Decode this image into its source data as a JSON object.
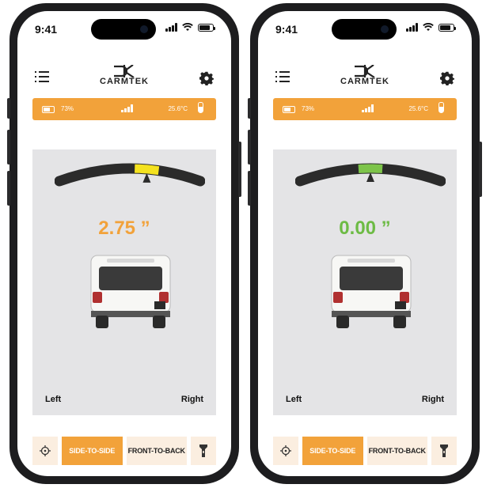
{
  "status": {
    "time": "9:41"
  },
  "brand": {
    "name": "CARMTEK"
  },
  "info": {
    "battery": "73%",
    "temperature": "25.6°C"
  },
  "labels": {
    "left": "Left",
    "right": "Right"
  },
  "tabs": {
    "side": "SIDE-TO-SIDE",
    "front": "FRONT-TO-BACK"
  },
  "icons": [
    "menu-icon",
    "gear-icon",
    "battery-icon",
    "signal-icon",
    "thermometer-icon",
    "target-icon",
    "flashlight-icon",
    "wifi-icon"
  ],
  "screens": [
    {
      "reading": "2.75 ”",
      "reading_color": "#f2a23a",
      "indicator_color": "#f4e21f",
      "indicator_level": 0.62
    },
    {
      "reading": "0.00 ”",
      "reading_color": "#6dbb45",
      "indicator_color": "#7dc44a",
      "indicator_level": 0.5
    }
  ],
  "colors": {
    "accent": "#f2a23a",
    "panel": "#e4e4e6",
    "button_bg": "#fbeee0"
  }
}
